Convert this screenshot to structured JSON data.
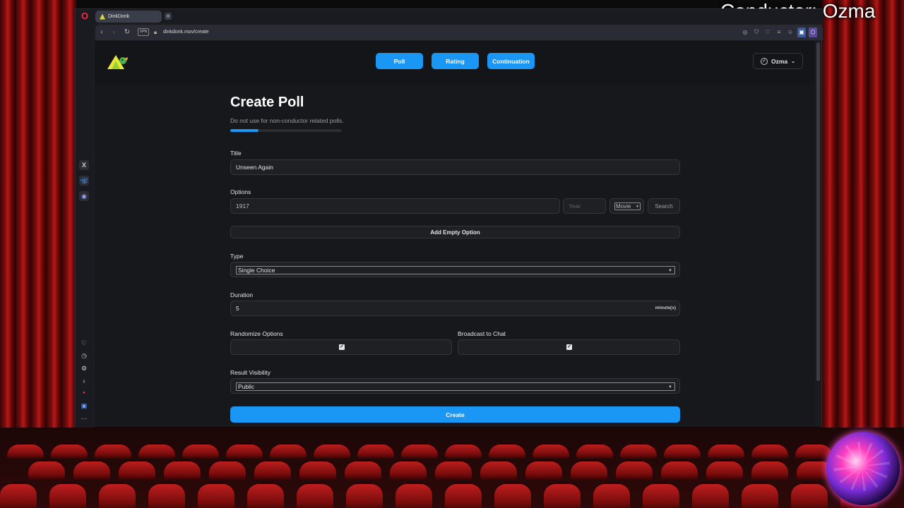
{
  "overlay": {
    "conductor_text": "Conductor: Ozma"
  },
  "browser": {
    "tab_title": "DinkDonk",
    "new_tab_symbol": "+",
    "url": "dinkdonk.mov/create",
    "vpn_label": "VPN"
  },
  "header": {
    "nav": [
      {
        "label": "Poll"
      },
      {
        "label": "Rating"
      },
      {
        "label": "Continuation"
      }
    ],
    "user_name": "Ozma"
  },
  "form": {
    "title": "Create Poll",
    "subtitle": "Do not use for non-conductor related polls.",
    "progress_fraction": 0.25,
    "title_label": "Title",
    "title_value": "Unseen Again",
    "options_label": "Options",
    "option_value": "1917",
    "year_placeholder": "Year",
    "media_type_selected": "Movie",
    "search_label": "Search",
    "add_empty_option_label": "Add Empty Option",
    "type_label": "Type",
    "type_selected": "Single Choice",
    "duration_label": "Duration",
    "duration_value": "5",
    "duration_unit": "minute(s)",
    "randomize_label": "Randomize Options",
    "randomize_checked": true,
    "broadcast_label": "Broadcast to Chat",
    "broadcast_checked": true,
    "visibility_label": "Result Visibility",
    "visibility_selected": "Public",
    "create_label": "Create"
  },
  "colors": {
    "accent": "#1a96f5",
    "page_bg": "#17181b",
    "field_bg": "#1f2024",
    "curtain_red": "#b81818"
  },
  "icons": {
    "opera": "opera-logo-icon",
    "user": "user-circle-icon",
    "sidebar": [
      "x-icon",
      "bluesky-icon",
      "discord-icon",
      "heart-icon",
      "history-icon",
      "settings-icon",
      "lightbulb-icon",
      "more-icon"
    ]
  }
}
